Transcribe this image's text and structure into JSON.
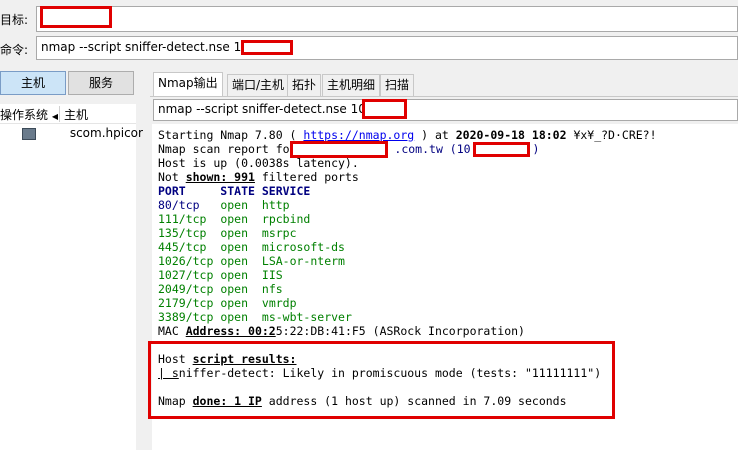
{
  "target": {
    "label": "目标:",
    "value": ""
  },
  "command": {
    "label": "命令:",
    "value": "nmap --script sniffer-detect.nse 10.1"
  },
  "left_tabs": [
    {
      "label": "主机"
    },
    {
      "label": "服务"
    }
  ],
  "host_list": {
    "col_os": "操作系统",
    "col_host": "主机",
    "rows": [
      {
        "host": "scom.hpicor"
      }
    ]
  },
  "output_tabs": [
    {
      "label": "Nmap输出"
    },
    {
      "label": "端口/主机"
    },
    {
      "label": "拓扑"
    },
    {
      "label": "主机明细"
    },
    {
      "label": "扫描"
    }
  ],
  "output_command": "nmap --script sniffer-detect.nse 10.1.",
  "output": {
    "l1_a": "Starting Nmap 7.80 ( ",
    "l1_link": "https://nmap.org",
    "l1_b": " ) at ",
    "l1_time": "2020-09-18 18:02",
    "l1_c": " ¥x¥_?D·CRE?!",
    "l2_a": "Nmap scan report for ",
    "l2_b": ".com.tw (10.",
    "l2_c": ")",
    "l3": "Host is up (0.0038s latency).",
    "l4_a": "Not ",
    "l4_b": "shown: 991",
    "l4_c": " filtered ports",
    "header": "PORT     STATE SERVICE",
    "ports": [
      {
        "port": "80/tcp",
        "state": "open",
        "service": "http"
      },
      {
        "port": "111/tcp",
        "state": "open",
        "service": "rpcbind"
      },
      {
        "port": "135/tcp",
        "state": "open",
        "service": "msrpc"
      },
      {
        "port": "445/tcp",
        "state": "open",
        "service": "microsoft-ds"
      },
      {
        "port": "1026/tcp",
        "state": "open",
        "service": "LSA-or-nterm"
      },
      {
        "port": "1027/tcp",
        "state": "open",
        "service": "IIS"
      },
      {
        "port": "2049/tcp",
        "state": "open",
        "service": "nfs"
      },
      {
        "port": "2179/tcp",
        "state": "open",
        "service": "vmrdp"
      },
      {
        "port": "3389/tcp",
        "state": "open",
        "service": "ms-wbt-server"
      }
    ],
    "mac_a": "MAC ",
    "mac_b": "Address: 00:2",
    "mac_c": "5:22:DB:41:F5 (ASRock Incorporation)",
    "script_a": "Host ",
    "script_b": "script results:",
    "sniff_a": "| s",
    "sniff_b": "niffer-detect: Likely in promiscuous mode (tests: \"11111111\")",
    "done_a": "Nmap ",
    "done_b": "done: 1 IP",
    "done_c": " address (1 host up) scanned in 7.09 seconds"
  },
  "colors": {
    "highlight_box": "#e00000",
    "port_green": "#008000",
    "port_blue": "#000080"
  }
}
